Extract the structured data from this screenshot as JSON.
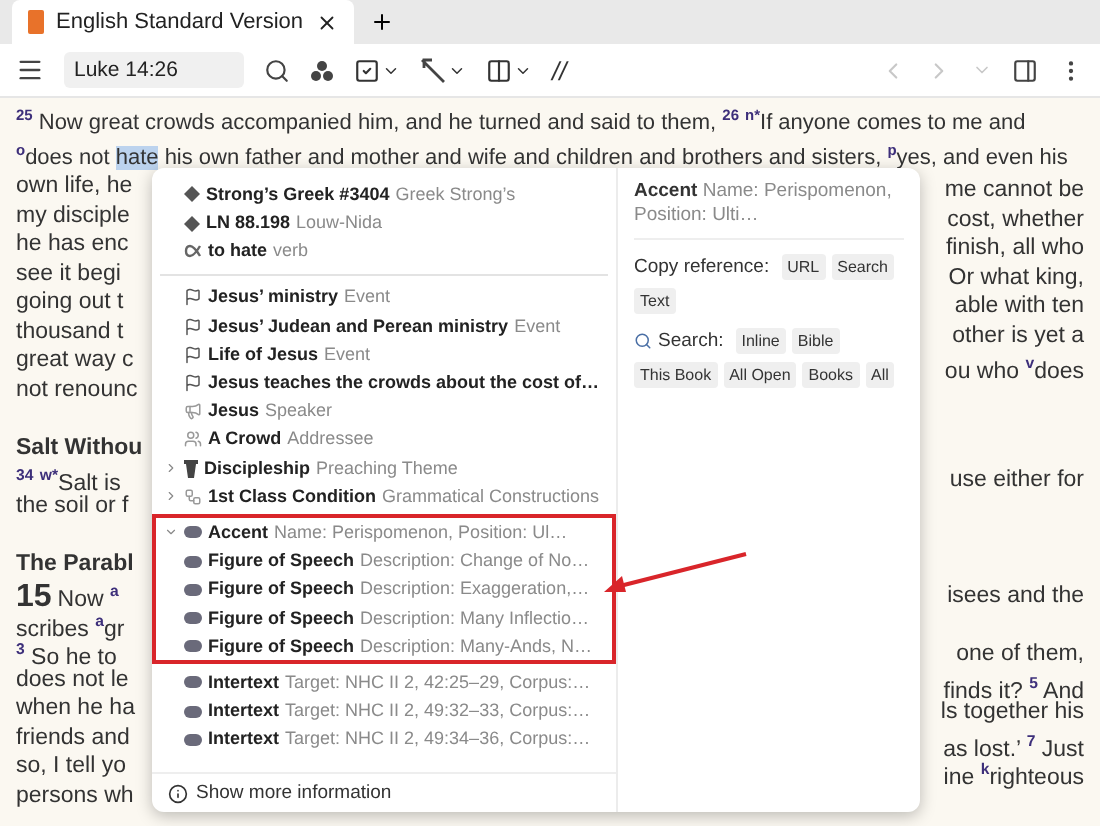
{
  "tab": {
    "title": "English Standard Version",
    "selected": true
  },
  "toolbar": {
    "reference": "Luke 14:26",
    "parallel_label": "//",
    "back_disabled": true,
    "forward_disabled": true
  },
  "passage": {
    "line_1": "$^{25}$ Now great crowds accompanied him, and he turned and said to them, $^{26}$ $^{n*}$If anyone comes to me and",
    "line_2": {
      "before": "$^{o}$does not",
      "selected_word": "hate",
      "after": "his own father and mother and wife and children and brothers and sisters, $^{p}$yes, and even his"
    },
    "left_fragments": [
      {
        "kind": "text",
        "text": "own life, he"
      },
      {
        "kind": "text",
        "text": "my disciple"
      },
      {
        "kind": "text",
        "text": "he has enc"
      },
      {
        "kind": "text",
        "text": "see it begi"
      },
      {
        "kind": "text",
        "text": "going out t"
      },
      {
        "kind": "text",
        "text": "thousand t"
      },
      {
        "kind": "text",
        "text": "great way c"
      },
      {
        "kind": "text",
        "text": "not renounc"
      },
      {
        "kind": "gap"
      },
      {
        "kind": "heading",
        "text": "Salt Withou"
      },
      {
        "kind": "text",
        "text": "$^{34}$ $^{w*}$Salt is"
      },
      {
        "kind": "text",
        "text": "the soil or f"
      },
      {
        "kind": "gap"
      },
      {
        "kind": "heading",
        "text": "The Parabl"
      },
      {
        "kind": "chapter",
        "number": "15",
        "text": "Now $^{a}$"
      },
      {
        "kind": "text",
        "text": "scribes $^{a}$gr"
      },
      {
        "kind": "text",
        "text": "$^{3}$ So he to"
      },
      {
        "kind": "text",
        "text": "does not le"
      },
      {
        "kind": "text",
        "text": "when he ha"
      },
      {
        "kind": "text",
        "text": "friends and"
      },
      {
        "kind": "text",
        "text": "so, I tell yo"
      },
      {
        "kind": "text",
        "text": "persons wh"
      }
    ],
    "right_fragments": [
      {
        "kind": "text",
        "text": "me cannot be"
      },
      {
        "kind": "text",
        "text": "cost, whether"
      },
      {
        "kind": "text",
        "text": "finish, all who"
      },
      {
        "kind": "text",
        "text": "Or what king,"
      },
      {
        "kind": "text",
        "text": "able with ten"
      },
      {
        "kind": "text",
        "text": "other is yet a"
      },
      {
        "kind": "text",
        "text": "ou who $^{v}$does"
      },
      {
        "kind": "gap"
      },
      {
        "kind": "gap"
      },
      {
        "kind": "gap"
      },
      {
        "kind": "text",
        "text": "use either for"
      },
      {
        "kind": "gap"
      },
      {
        "kind": "gap"
      },
      {
        "kind": "gap"
      },
      {
        "kind": "text",
        "text": "isees and the"
      },
      {
        "kind": "gap"
      },
      {
        "kind": "text",
        "text": "one of them,"
      },
      {
        "kind": "text",
        "text": "finds it? $^{5}$ And"
      },
      {
        "kind": "text",
        "text": "ls together his"
      },
      {
        "kind": "text",
        "text": "as lost.’ $^{7}$ Just"
      },
      {
        "kind": "text",
        "text": "ine $^{k}$righteous"
      }
    ]
  },
  "popup": {
    "sections": [
      {
        "highlighted": false,
        "items": [
          {
            "kind": "lexicon",
            "label": "Strong’s Greek #3404",
            "detail": "Greek Strong’s"
          },
          {
            "kind": "lexicon",
            "label": "LN 88.198",
            "detail": "Louw-Nida"
          },
          {
            "kind": "lemma",
            "label": "to hate",
            "detail": "verb"
          }
        ]
      },
      {
        "highlighted": false,
        "items": [
          {
            "kind": "event",
            "label": "Jesus’ ministry",
            "detail": "Event"
          },
          {
            "kind": "event",
            "label": "Jesus’ Judean and Perean ministry",
            "detail": "Event"
          },
          {
            "kind": "event",
            "label": "Life of Jesus",
            "detail": "Event"
          },
          {
            "kind": "event",
            "label": "Jesus teaches the crowds about the cost of…"
          },
          {
            "kind": "speaker",
            "label": "Jesus",
            "detail": "Speaker"
          },
          {
            "kind": "addressee",
            "label": "A Crowd",
            "detail": "Addressee"
          },
          {
            "kind": "theme",
            "label": "Discipleship",
            "detail": "Preaching Theme",
            "expanded": false
          },
          {
            "kind": "construction",
            "label": "1st Class Condition",
            "detail": "Grammatical Constructions",
            "expanded": false
          }
        ]
      },
      {
        "highlighted": true,
        "items": [
          {
            "kind": "label",
            "label": "Accent",
            "detail": "Name: Perispomenon, Position: Ul…",
            "expanded": true
          },
          {
            "kind": "label",
            "label": "Figure of Speech",
            "detail": "Description: Change of No…"
          },
          {
            "kind": "label",
            "label": "Figure of Speech",
            "detail": "Description: Exaggeration,…"
          },
          {
            "kind": "label",
            "label": "Figure of Speech",
            "detail": "Description: Many Inflectio…"
          },
          {
            "kind": "label",
            "label": "Figure of Speech",
            "detail": "Description: Many-Ands, N…"
          }
        ]
      },
      {
        "highlighted": false,
        "items": [
          {
            "kind": "label",
            "label": "Intertext",
            "detail": "Target: NHC II 2, 42:25–29, Corpus:…"
          },
          {
            "kind": "label",
            "label": "Intertext",
            "detail": "Target: NHC II 2, 49:32–33, Corpus:…"
          },
          {
            "kind": "label",
            "label": "Intertext",
            "detail": "Target: NHC II 2, 49:34–36, Corpus:…"
          }
        ]
      }
    ],
    "show_more": "Show more information",
    "detail": {
      "title": "Accent",
      "subtitle": "Name: Perispomenon, Position: Ulti…",
      "copy_label": "Copy reference:",
      "copy_buttons": [
        "URL",
        "Search",
        "Text"
      ],
      "search_label": "Search:",
      "search_buttons": [
        "Inline",
        "Bible",
        "This Book",
        "All Open",
        "Books",
        "All"
      ]
    }
  }
}
